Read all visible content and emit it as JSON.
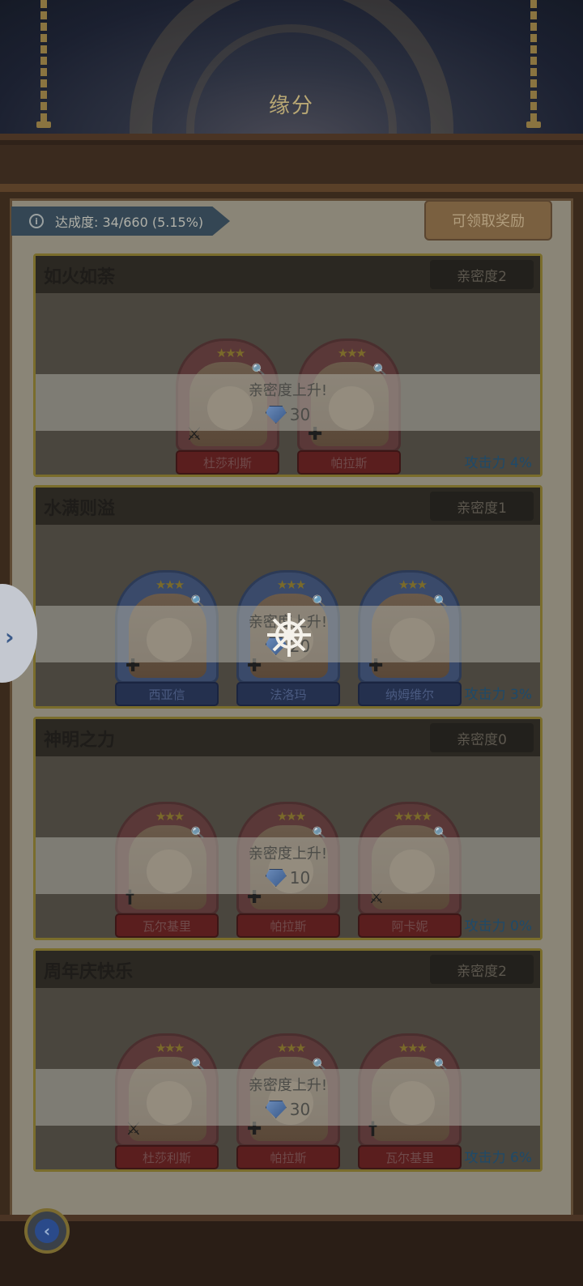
{
  "header": {
    "title": "缘分"
  },
  "progress": {
    "achievement_label": "达成度: 34/660 (5.15%)",
    "achieved": 34,
    "total": 660,
    "percent": 5.15
  },
  "claim_button": {
    "label": "可领取奖励"
  },
  "bonds": [
    {
      "title": "如火如荼",
      "intimacy": "亲密度2",
      "bonus": "攻击力 4%",
      "reward_text": "亲密度上升!",
      "reward_amount": "30",
      "heroes": [
        {
          "name": "杜莎利斯",
          "stars": 3,
          "role_icon": "sword-icon",
          "frame": "red"
        },
        {
          "name": "帕拉斯",
          "stars": 3,
          "role_icon": "plus-icon",
          "frame": "red"
        }
      ]
    },
    {
      "title": "水满则溢",
      "intimacy": "亲密度1",
      "bonus": "攻击力 3%",
      "reward_text": "亲密度上升!",
      "reward_amount": "20",
      "heroes": [
        {
          "name": "西亚信",
          "stars": 3,
          "role_icon": "plus-icon",
          "frame": "blue"
        },
        {
          "name": "法洛玛",
          "stars": 3,
          "role_icon": "plus-icon",
          "frame": "blue"
        },
        {
          "name": "纳姆维尔",
          "stars": 3,
          "role_icon": "plus-icon",
          "frame": "blue"
        }
      ]
    },
    {
      "title": "神明之力",
      "intimacy": "亲密度0",
      "bonus": "攻击力 0%",
      "reward_text": "亲密度上升!",
      "reward_amount": "10",
      "heroes": [
        {
          "name": "瓦尔基里",
          "stars": 3,
          "role_icon": "dagger-icon",
          "frame": "red"
        },
        {
          "name": "帕拉斯",
          "stars": 3,
          "role_icon": "plus-icon",
          "frame": "red"
        },
        {
          "name": "阿卡妮",
          "stars": 4,
          "role_icon": "sword-icon",
          "frame": "red"
        }
      ]
    },
    {
      "title": "周年庆快乐",
      "intimacy": "亲密度2",
      "bonus": "攻击力 6%",
      "reward_text": "亲密度上升!",
      "reward_amount": "30",
      "heroes": [
        {
          "name": "杜莎利斯",
          "stars": 3,
          "role_icon": "sword-icon",
          "frame": "red"
        },
        {
          "name": "帕拉斯",
          "stars": 3,
          "role_icon": "plus-icon",
          "frame": "red"
        },
        {
          "name": "瓦尔基里",
          "stars": 3,
          "role_icon": "dagger-icon",
          "frame": "red"
        }
      ]
    }
  ],
  "icons": {
    "info": "info-icon",
    "side_tab": "chevron-right-icon",
    "loading": "ship-wheel-icon",
    "back": "back-arrow-icon",
    "gem": "diamond-icon"
  }
}
